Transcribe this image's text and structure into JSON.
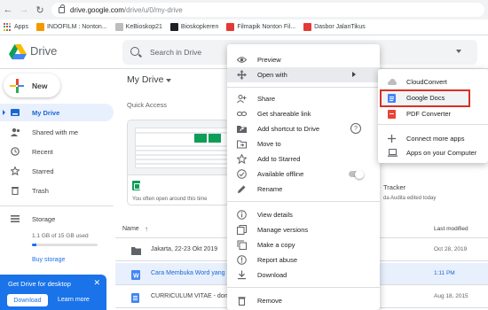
{
  "browser": {
    "url_host": "drive.google.com",
    "url_path": "/drive/u/0/my-drive",
    "bookmarks": [
      {
        "label": "Apps",
        "icon": "apps-grid-icon"
      },
      {
        "label": "INDOFILM : Nonton...",
        "icon": "indofilm-favicon",
        "color": "#f29900"
      },
      {
        "label": "KeBioskop21",
        "icon": "kebioskop-favicon",
        "color": "#bdbdbd"
      },
      {
        "label": "Bioskopkeren",
        "icon": "bioskopkeren-favicon",
        "color": "#202124"
      },
      {
        "label": "Filmapik Nonton Fil...",
        "icon": "filmapik-favicon",
        "color": "#e53935"
      },
      {
        "label": "Dasbor JalanTikus",
        "icon": "jalantikus-favicon",
        "color": "#e53935"
      }
    ]
  },
  "app": {
    "title": "Drive",
    "search_placeholder": "Search in Drive"
  },
  "sidebar": {
    "new_label": "New",
    "items": [
      {
        "label": "My Drive",
        "icon": "drive-icon"
      },
      {
        "label": "Shared with me",
        "icon": "people-icon"
      },
      {
        "label": "Recent",
        "icon": "clock-icon"
      },
      {
        "label": "Starred",
        "icon": "star-icon"
      },
      {
        "label": "Trash",
        "icon": "trash-icon"
      }
    ],
    "storage_label": "Storage",
    "storage_used": "1.1 GB of 15 GB used",
    "storage_fraction": 0.073,
    "buy_storage": "Buy storage",
    "promo": {
      "title": "Get Drive for desktop",
      "download": "Download",
      "learn_more": "Learn more"
    }
  },
  "main": {
    "title": "My Drive",
    "quick_access": "Quick Access",
    "cards": [
      {
        "subtitle": "You often open around this time",
        "icon": "sheets-icon"
      },
      {
        "title": "Tracker",
        "subtitle": "da Audita edited today"
      }
    ],
    "list": {
      "col_name": "Name",
      "col_modified": "Last modified",
      "rows": [
        {
          "name": "Jakarta, 22-23 Okt 2019",
          "modified": "Oct 28, 2019",
          "icon": "folder-icon"
        },
        {
          "name": "Cara Membuka Word yang",
          "modified": "1:11 PM",
          "icon": "word-icon"
        },
        {
          "name": "CURRICULUM VITAE - done",
          "modified": "Aug 18, 2015",
          "icon": "docs-icon"
        }
      ]
    }
  },
  "context_menu": {
    "items": [
      {
        "label": "Preview",
        "icon": "eye-icon"
      },
      {
        "label": "Open with",
        "icon": "move-arrows-icon"
      },
      {
        "label": "Share",
        "icon": "person-add-icon"
      },
      {
        "label": "Get shareable link",
        "icon": "link-icon"
      },
      {
        "label": "Add shortcut to Drive",
        "icon": "shortcut-icon",
        "help": "?"
      },
      {
        "label": "Move to",
        "icon": "folder-move-icon"
      },
      {
        "label": "Add to Starred",
        "icon": "star-icon"
      },
      {
        "label": "Available offline",
        "icon": "offline-check-icon"
      },
      {
        "label": "Rename",
        "icon": "pencil-icon"
      },
      {
        "label": "View details",
        "icon": "info-icon"
      },
      {
        "label": "Manage versions",
        "icon": "history-icon"
      },
      {
        "label": "Make a copy",
        "icon": "copy-icon"
      },
      {
        "label": "Report abuse",
        "icon": "report-icon"
      },
      {
        "label": "Download",
        "icon": "download-icon"
      },
      {
        "label": "Remove",
        "icon": "trash-icon"
      }
    ]
  },
  "open_with_menu": {
    "items": [
      {
        "label": "CloudConvert",
        "icon": "cloudconvert-icon"
      },
      {
        "label": "Google Docs",
        "icon": "docs-icon"
      },
      {
        "label": "PDF Converter",
        "icon": "pdf-converter-icon"
      },
      {
        "label": "Connect more apps",
        "icon": "plus-icon"
      },
      {
        "label": "Apps on your Computer",
        "icon": "laptop-icon"
      }
    ]
  },
  "colors": {
    "accent": "#1a73e8",
    "highlight_border": "#d93025",
    "selected_bg": "#e8f0fe"
  }
}
